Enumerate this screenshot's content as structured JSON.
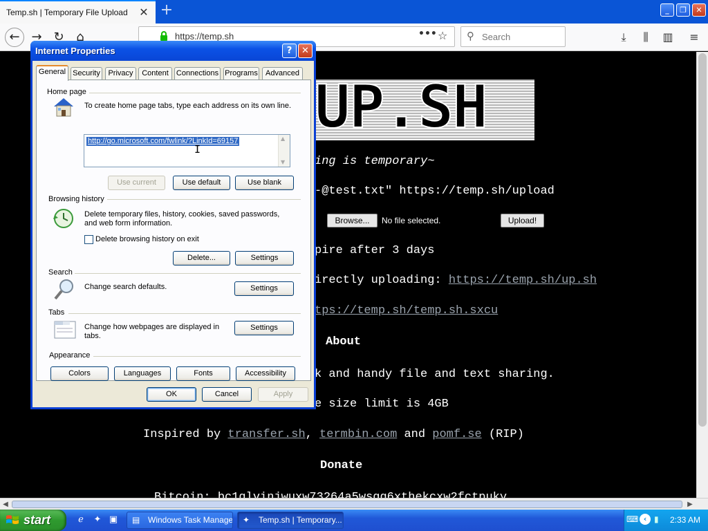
{
  "browser": {
    "tab_title": "Temp.sh | Temporary File Upload",
    "tab_close": "✕",
    "new_tab": "+",
    "url": "https://temp.sh",
    "url_actions": "•••",
    "search_placeholder": "Search"
  },
  "page": {
    "tagline": "ing is temporary~",
    "curl_cmd": "-@test.txt\" https://temp.sh/upload",
    "browse_label": "Browse...",
    "file_status": "No file selected.",
    "upload_label": "Upload!",
    "expire_text": "pire after 3 days",
    "direct_prefix": "irectly uploading: ",
    "direct_link": "https://temp.sh/up.sh",
    "sxcu_link": "tps://temp.sh/temp.sh.sxcu",
    "about_heading": "About",
    "about_text": "k and handy file and text sharing.",
    "limit_text": "e size limit is 4GB",
    "inspired_prefix": "Inspired by ",
    "inspired_link1": "transfer.sh",
    "inspired_sep": ", ",
    "inspired_link2": "termbin.com",
    "inspired_and": " and ",
    "inspired_link3": "pomf.se",
    "inspired_suffix": " (RIP)",
    "donate_heading": "Donate",
    "bitcoin_text": "Bitcoin: bc1qlvinjwuxw73264a5wsgg6xthekcxw2fctpuky"
  },
  "dialog": {
    "title": "Internet Properties",
    "help_btn": "?",
    "close_btn": "✕",
    "tabs": [
      "General",
      "Security",
      "Privacy",
      "Content",
      "Connections",
      "Programs",
      "Advanced"
    ],
    "home_page": {
      "heading": "Home page",
      "description": "To create home page tabs, type each address on its own line.",
      "value": "http://go.microsoft.com/fwlink/?LinkId=69157",
      "use_current": "Use current",
      "use_default": "Use default",
      "use_blank": "Use blank"
    },
    "browsing_history": {
      "heading": "Browsing history",
      "description": "Delete temporary files, history, cookies, saved passwords, and web form information.",
      "checkbox_label": "Delete browsing history on exit",
      "delete_btn": "Delete...",
      "settings_btn": "Settings"
    },
    "search": {
      "heading": "Search",
      "description": "Change search defaults.",
      "settings_btn": "Settings"
    },
    "tabs_section": {
      "heading": "Tabs",
      "description": "Change how webpages are displayed in tabs.",
      "settings_btn": "Settings"
    },
    "appearance": {
      "heading": "Appearance",
      "colors_btn": "Colors",
      "languages_btn": "Languages",
      "fonts_btn": "Fonts",
      "accessibility_btn": "Accessibility"
    },
    "ok_btn": "OK",
    "cancel_btn": "Cancel",
    "apply_btn": "Apply"
  },
  "taskbar": {
    "start_label": "start",
    "buttons": [
      "Windows Task Manager",
      "Temp.sh | Temporary..."
    ],
    "clock": "2:33 AM"
  },
  "colors": {
    "xp_blue": "#0a46d6",
    "start_green": "#2f9a2f",
    "dialog_bg": "#ece9d8",
    "selection": "#316ac5"
  }
}
